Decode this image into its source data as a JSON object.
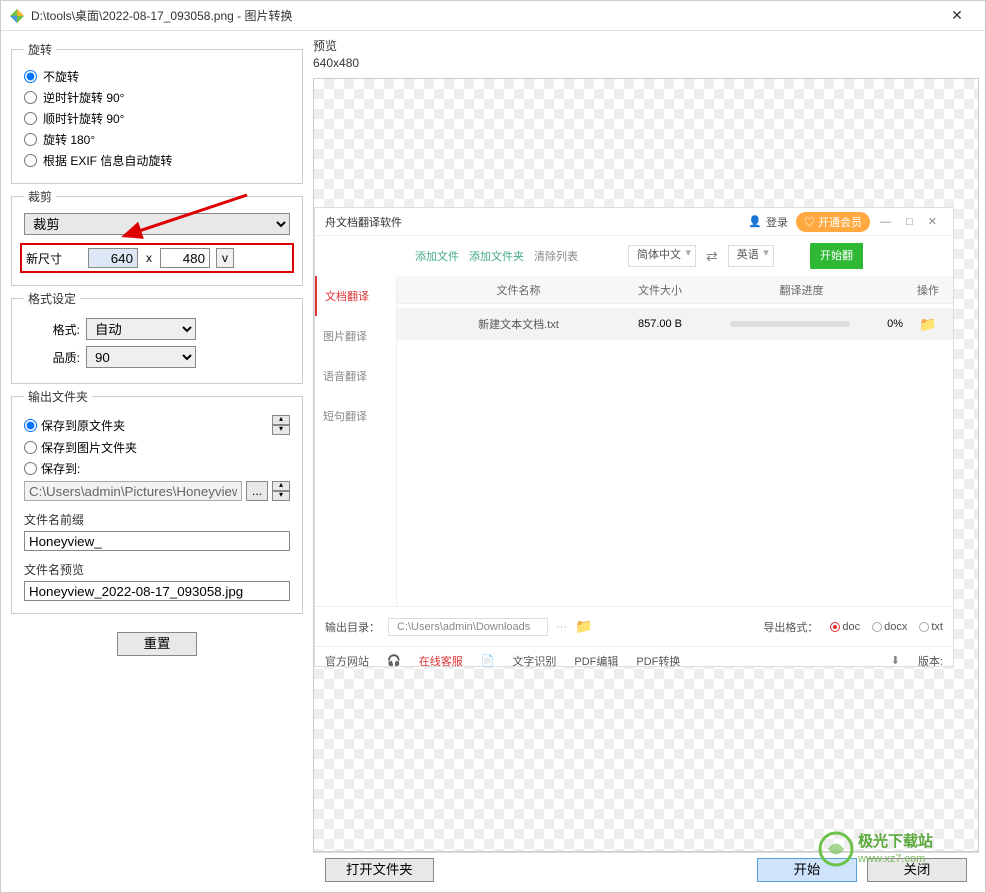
{
  "titlebar": {
    "path": "D:\\tools\\桌面\\2022-08-17_093058.png - 图片转换",
    "close": "✕"
  },
  "rotate": {
    "legend": "旋转",
    "opt1": "不旋转",
    "opt2": "逆时针旋转 90°",
    "opt3": "顺时针旋转 90°",
    "opt4": "旋转 180°",
    "opt5": "根据 EXIF 信息自动旋转"
  },
  "crop": {
    "legend": "裁剪",
    "select_label": "裁剪",
    "size_label": "新尺寸",
    "width": "640",
    "height": "480",
    "x": "x",
    "vbtn": "v"
  },
  "format": {
    "legend": "格式设定",
    "fmt_label": "格式:",
    "fmt_value": "自动",
    "qual_label": "品质:",
    "qual_value": "90"
  },
  "output": {
    "legend": "输出文件夹",
    "opt1": "保存到原文件夹",
    "opt2": "保存到图片文件夹",
    "opt3": "保存到:",
    "path": "C:\\Users\\admin\\Pictures\\Honeyview",
    "dots": "...",
    "prefix_label": "文件名前缀",
    "prefix_value": "Honeyview_",
    "preview_label": "文件名预览",
    "preview_value": "Honeyview_2022-08-17_093058.jpg"
  },
  "reset": "重置",
  "preview": {
    "title": "预览",
    "size": "640x480"
  },
  "embedded": {
    "title": "舟文档翻译软件",
    "login_icon": "👤",
    "login": "登录",
    "vip": "♡ 开通会员",
    "winbtns": "— □ ✕",
    "tb_addfile": "添加文件",
    "tb_addfolder": "添加文件夹",
    "tb_clear": "清除列表",
    "lang_from": "简体中文",
    "swap": "⇄",
    "lang_to": "英语",
    "start": "开始翻",
    "side_doc": "文档翻译",
    "side_img": "图片翻译",
    "side_voice": "语音翻译",
    "side_short": "短句翻译",
    "th_name": "文件名称",
    "th_size": "文件大小",
    "th_prog": "翻译进度",
    "th_op": "操作",
    "row_name": "新建文本文档.txt",
    "row_size": "857.00 B",
    "row_prog": "0%",
    "fold_icon": "📁",
    "out_label": "输出目录：",
    "out_path": "C:\\Users\\admin\\Downloads",
    "out_dots": "···",
    "out_fold": "📁",
    "fmt_label": "导出格式：",
    "fmt_doc": "doc",
    "fmt_docx": "docx",
    "fmt_txt": "txt",
    "bt_site": "官方网站",
    "bt_service": "在线客服",
    "bt_ocr": "文字识别",
    "bt_pdfedit": "PDF编辑",
    "bt_pdfconv": "PDF转换",
    "bt_dl": "⬇",
    "bt_ver": "版本:"
  },
  "footer": {
    "open": "打开文件夹",
    "start": "开始",
    "close": "关闭"
  },
  "watermark": {
    "line1": "极光下载站",
    "line2": "www.xz7.com"
  }
}
